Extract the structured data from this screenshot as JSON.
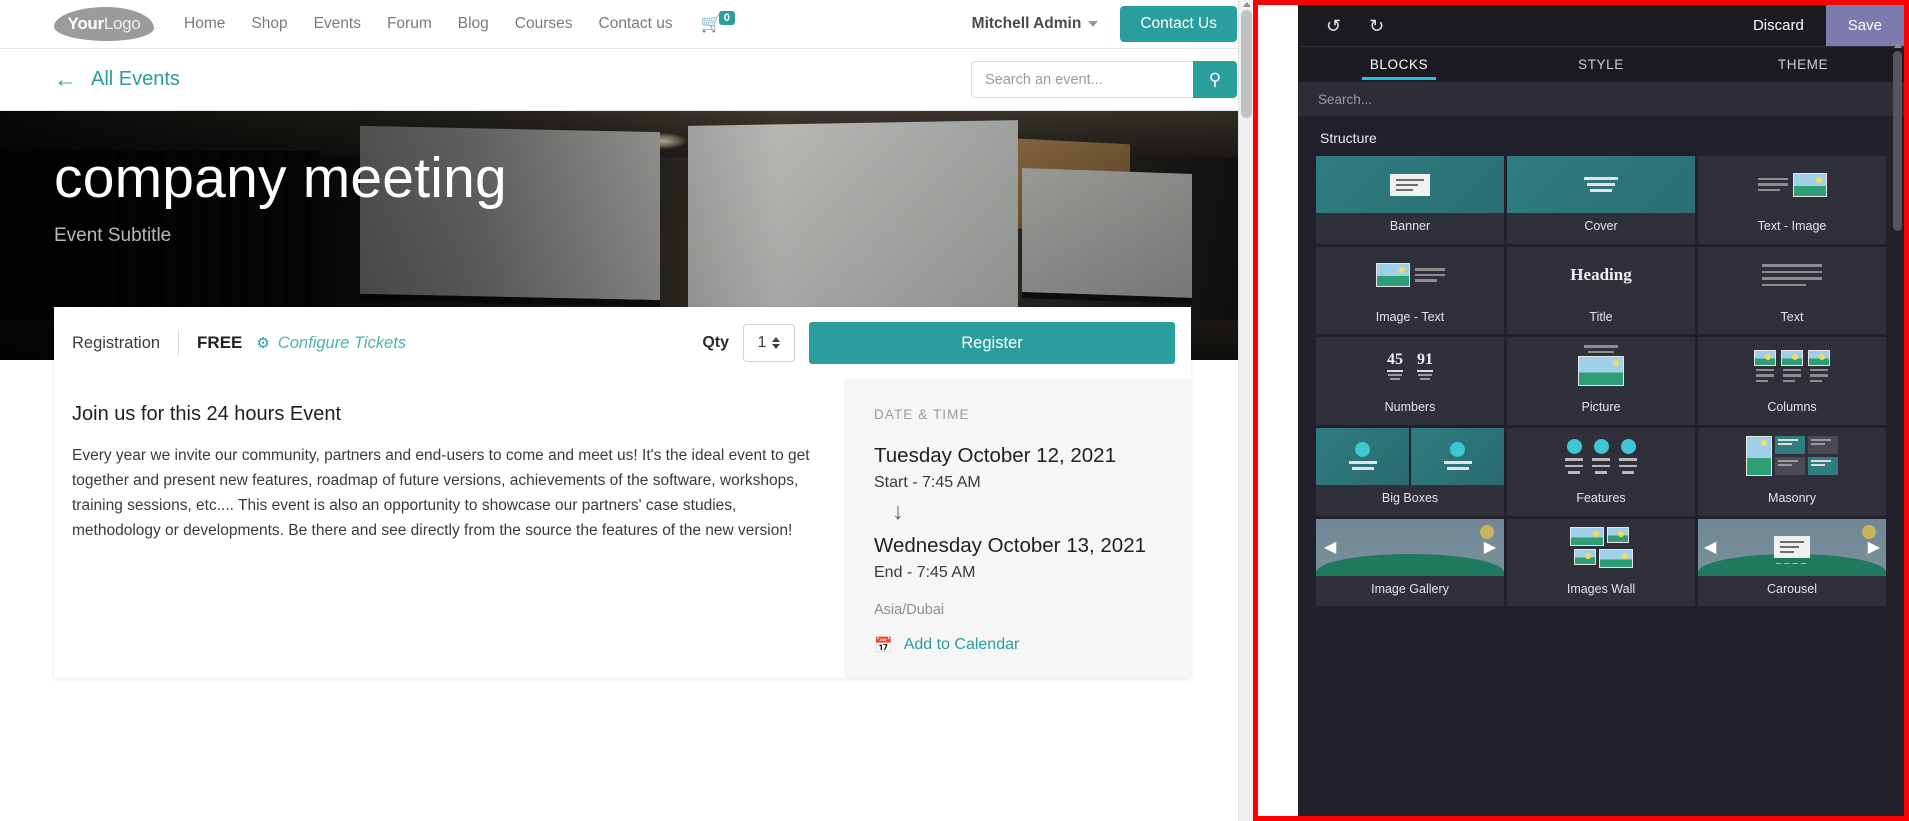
{
  "nav": {
    "logo_bold": "Your",
    "logo_light": "Logo",
    "links": [
      "Home",
      "Shop",
      "Events",
      "Forum",
      "Blog",
      "Courses",
      "Contact us"
    ],
    "cart_count": "0",
    "user": "Mitchell Admin",
    "contact_button": "Contact Us"
  },
  "subheader": {
    "back_label": "All Events",
    "back_arrow": "←",
    "search_placeholder": "Search an event...",
    "search_value": "",
    "search_icon": "🔍"
  },
  "hero": {
    "title": "company meeting",
    "subtitle": "Event Subtitle"
  },
  "registration": {
    "label": "Registration",
    "price": "FREE",
    "configure_tickets": "Configure Tickets",
    "gear_icon": "⚙",
    "qty_label": "Qty",
    "qty_value": "1",
    "register_button": "Register"
  },
  "event": {
    "heading": "Join us for this 24 hours Event",
    "body": "Every year we invite our community, partners and end-users to come and meet us! It's the ideal event to get together and present new features, roadmap of future versions, achievements of the software, workshops, training sessions, etc.... This event is also an opportunity to showcase our partners' case studies, methodology or developments. Be there and see directly from the source the features of the new version!"
  },
  "datetime": {
    "section_title": "DATE & TIME",
    "start_date": "Tuesday October 12, 2021",
    "start_time": "Start - 7:45 AM",
    "arrow": "↓",
    "end_date": "Wednesday October 13, 2021",
    "end_time": "End - 7:45 AM",
    "timezone": "Asia/Dubai",
    "calendar_icon": "📅",
    "calendar_link": "Add to Calendar"
  },
  "editor": {
    "undo_icon": "↺",
    "redo_icon": "↻",
    "discard": "Discard",
    "save": "Save",
    "tabs": [
      {
        "label": "BLOCKS",
        "active": true
      },
      {
        "label": "STYLE",
        "active": false
      },
      {
        "label": "THEME",
        "active": false
      }
    ],
    "search_placeholder": "Search...",
    "section_title": "Structure",
    "blocks": [
      {
        "label": "Banner"
      },
      {
        "label": "Cover"
      },
      {
        "label": "Text - Image"
      },
      {
        "label": "Image - Text"
      },
      {
        "label": "Title"
      },
      {
        "label": "Text"
      },
      {
        "label": "Numbers"
      },
      {
        "label": "Picture"
      },
      {
        "label": "Columns"
      },
      {
        "label": "Big Boxes"
      },
      {
        "label": "Features"
      },
      {
        "label": "Masonry"
      },
      {
        "label": "Image Gallery"
      },
      {
        "label": "Images Wall"
      },
      {
        "label": "Carousel"
      }
    ],
    "numbers_thumb": {
      "n1": "45",
      "n2": "91"
    },
    "title_thumb_word": "Heading",
    "colors": {
      "save_bg": "#7c7bad",
      "tab_underline": "#23c4dd",
      "panel_bg": "#21212b",
      "border": "#fe0000"
    }
  }
}
